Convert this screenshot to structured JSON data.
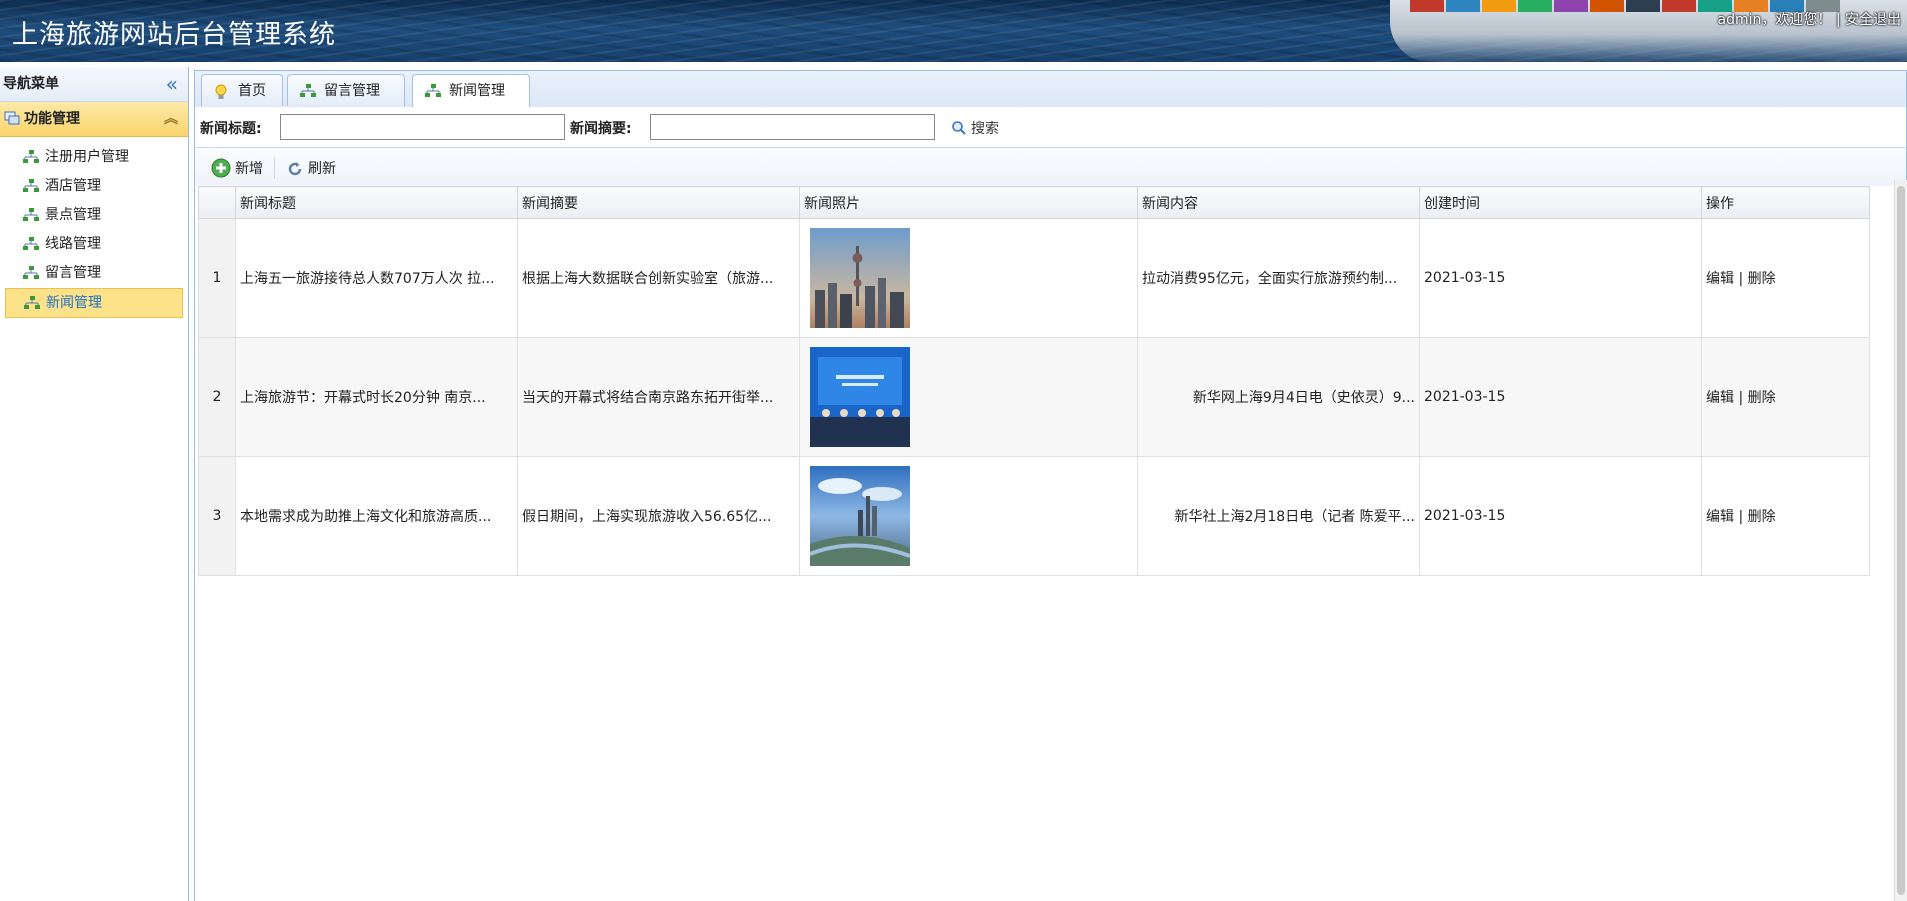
{
  "app": {
    "title": "上海旅游网站后台管理系统",
    "user_greeting": "admin，欢迎您！",
    "separator": "|",
    "logout_label": "安全退出"
  },
  "nav": {
    "header": "导航菜单",
    "group": "功能管理",
    "items": [
      {
        "label": "注册用户管理"
      },
      {
        "label": "酒店管理"
      },
      {
        "label": "景点管理"
      },
      {
        "label": "线路管理"
      },
      {
        "label": "留言管理"
      },
      {
        "label": "新闻管理",
        "active": true
      }
    ]
  },
  "tabs": [
    {
      "label": "首页",
      "icon": "lightbulb-icon"
    },
    {
      "label": "留言管理",
      "icon": "tree-icon",
      "close": "×"
    },
    {
      "label": "新闻管理",
      "icon": "tree-icon",
      "close": "×",
      "active": true
    }
  ],
  "search": {
    "title_label": "新闻标题:",
    "title_value": "",
    "summary_label": "新闻摘要:",
    "summary_value": "",
    "button_label": "搜索"
  },
  "toolbar": {
    "add_label": "新增",
    "refresh_label": "刷新"
  },
  "table": {
    "columns": [
      "新闻标题",
      "新闻摘要",
      "新闻照片",
      "新闻内容",
      "创建时间",
      "操作"
    ],
    "rows": [
      {
        "num": "1",
        "title": "上海五一旅游接待总人数707万人次 拉...",
        "summary": "根据上海大数据联合创新实验室（旅游...",
        "content": "拉动消费95亿元，全面实行旅游预约制...",
        "created": "2021-03-15",
        "edit": "编辑",
        "sep": "|",
        "delete": "删除"
      },
      {
        "num": "2",
        "title": "上海旅游节：开幕式时长20分钟 南京...",
        "summary": "当天的开幕式将结合南京路东拓开街举...",
        "content": "新华网上海9月4日电（史依灵）9...",
        "created": "2021-03-15",
        "edit": "编辑",
        "sep": "|",
        "delete": "删除"
      },
      {
        "num": "3",
        "title": "本地需求成为助推上海文化和旅游高质...",
        "summary": "假日期间，上海实现旅游收入56.65亿...",
        "content": "新华社上海2月18日电（记者 陈爱平...",
        "created": "2021-03-15",
        "edit": "编辑",
        "sep": "|",
        "delete": "删除"
      }
    ]
  },
  "colors": {
    "accent": "#1f6fc5",
    "nav_active": "#fde28a",
    "border": "#99bbe8"
  }
}
